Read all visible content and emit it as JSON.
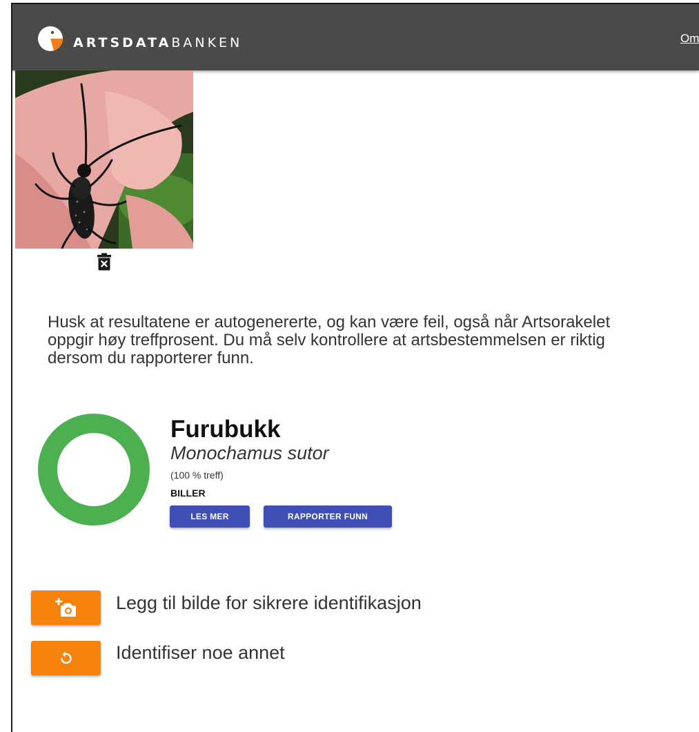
{
  "header": {
    "brand_bold": "ARTSDATA",
    "brand_light": "BANKEN",
    "nav_link": "Om"
  },
  "upload": {
    "delete_icon": "trash-x-icon"
  },
  "disclaimer": "Husk at resultatene er autogenererte, og kan være feil, også når Artsorakelet oppgir høy treffprosent. Du må selv kontrollere at artsbestemmelsen er riktig dersom du rapporterer funn.",
  "result": {
    "name": "Furubukk",
    "scientific_name": "Monochamus sutor",
    "match_text": "(100 % treff)",
    "match_fraction": 1.0,
    "group": "BILLER",
    "read_more": "LES MER",
    "report": "RAPPORTER FUNN",
    "ring_color": "#4caf50"
  },
  "actions": {
    "add_image": "Legg til bilde for sikrere identifikasjon",
    "identify_other": "Identifiser noe annet"
  },
  "colors": {
    "header_bg": "#4a4a48",
    "button_blue": "#3f4fb5",
    "button_orange": "#f5820d"
  }
}
